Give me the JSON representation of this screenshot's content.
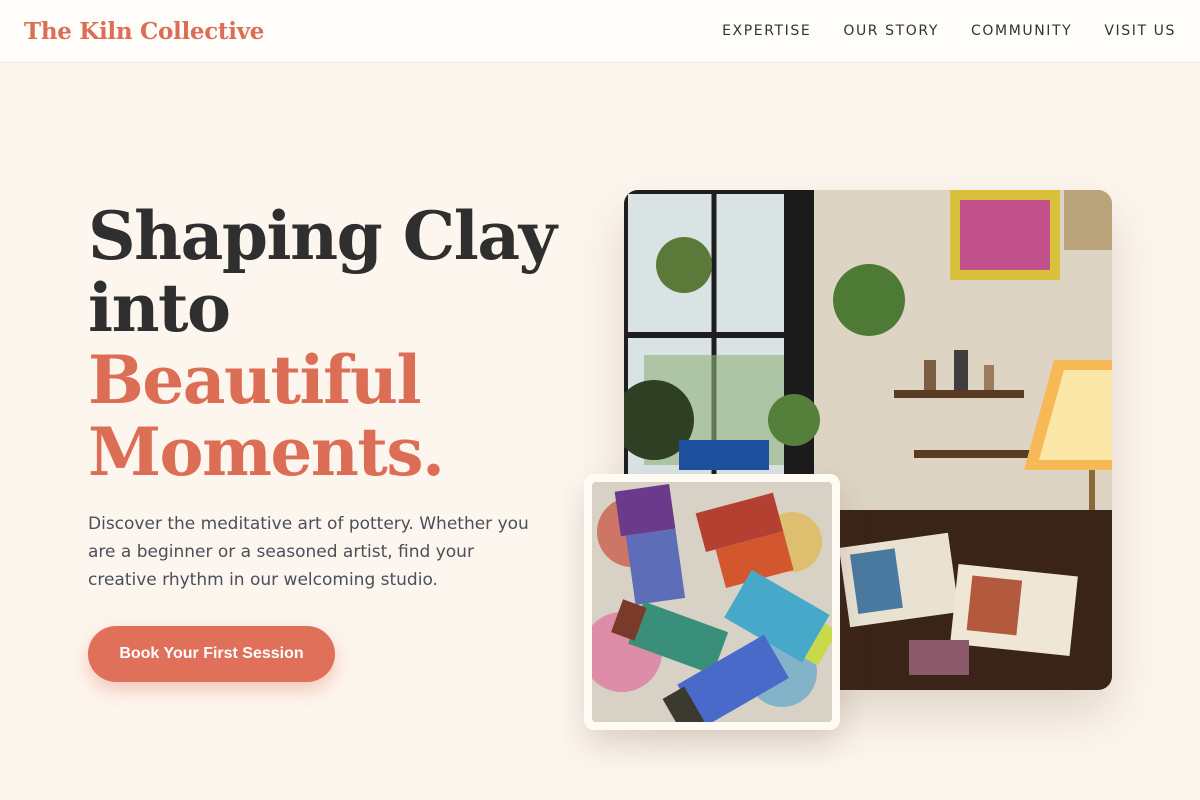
{
  "brand": {
    "name": "The Kiln Collective"
  },
  "nav": {
    "items": [
      "EXPERTISE",
      "OUR STORY",
      "COMMUNITY",
      "VISIT US"
    ]
  },
  "hero": {
    "title_lines": [
      "Shaping Clay",
      "into"
    ],
    "title_accent_lines": [
      "Beautiful",
      "Moments."
    ],
    "description": "Discover the meditative art of pottery. Whether you are a beginner or a seasoned artist, find your creative rhythm in our welcoming studio.",
    "cta_label": "Book Your First Session"
  },
  "colors": {
    "accent": "#dc6e55",
    "background": "#fdf6ee",
    "heading": "#2f2f2f",
    "body_text": "#4a4f5a"
  }
}
